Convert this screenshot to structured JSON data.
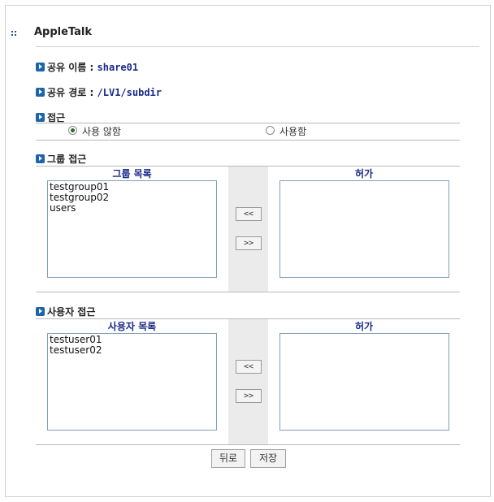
{
  "window": {
    "title": "AppleTalk"
  },
  "share": {
    "name_label": "공유 이름 :",
    "name_value": "share01",
    "path_label": "공유 경로 :",
    "path_value": "/LV1/subdir"
  },
  "access": {
    "label": "접근",
    "options": [
      {
        "label": "사용 않함",
        "selected": true
      },
      {
        "label": "사용함",
        "selected": false
      }
    ]
  },
  "group_access": {
    "label": "그룹 접근",
    "list_title": "그룹 목록",
    "allowed_title": "허가",
    "items": [
      "testgroup01",
      "testgroup02",
      "users"
    ],
    "allowed_items": [],
    "move_left": "<<",
    "move_right": ">>"
  },
  "user_access": {
    "label": "사용자 접근",
    "list_title": "사용자 목록",
    "allowed_title": "허가",
    "items": [
      "testuser01",
      "testuser02"
    ],
    "allowed_items": [],
    "move_left": "<<",
    "move_right": ">>"
  },
  "buttons": {
    "back": "뒤로",
    "save": "저장"
  },
  "colors": {
    "accent": "#1a2a8a",
    "icon": "#1e64a8",
    "list_border": "#7f9db9"
  }
}
